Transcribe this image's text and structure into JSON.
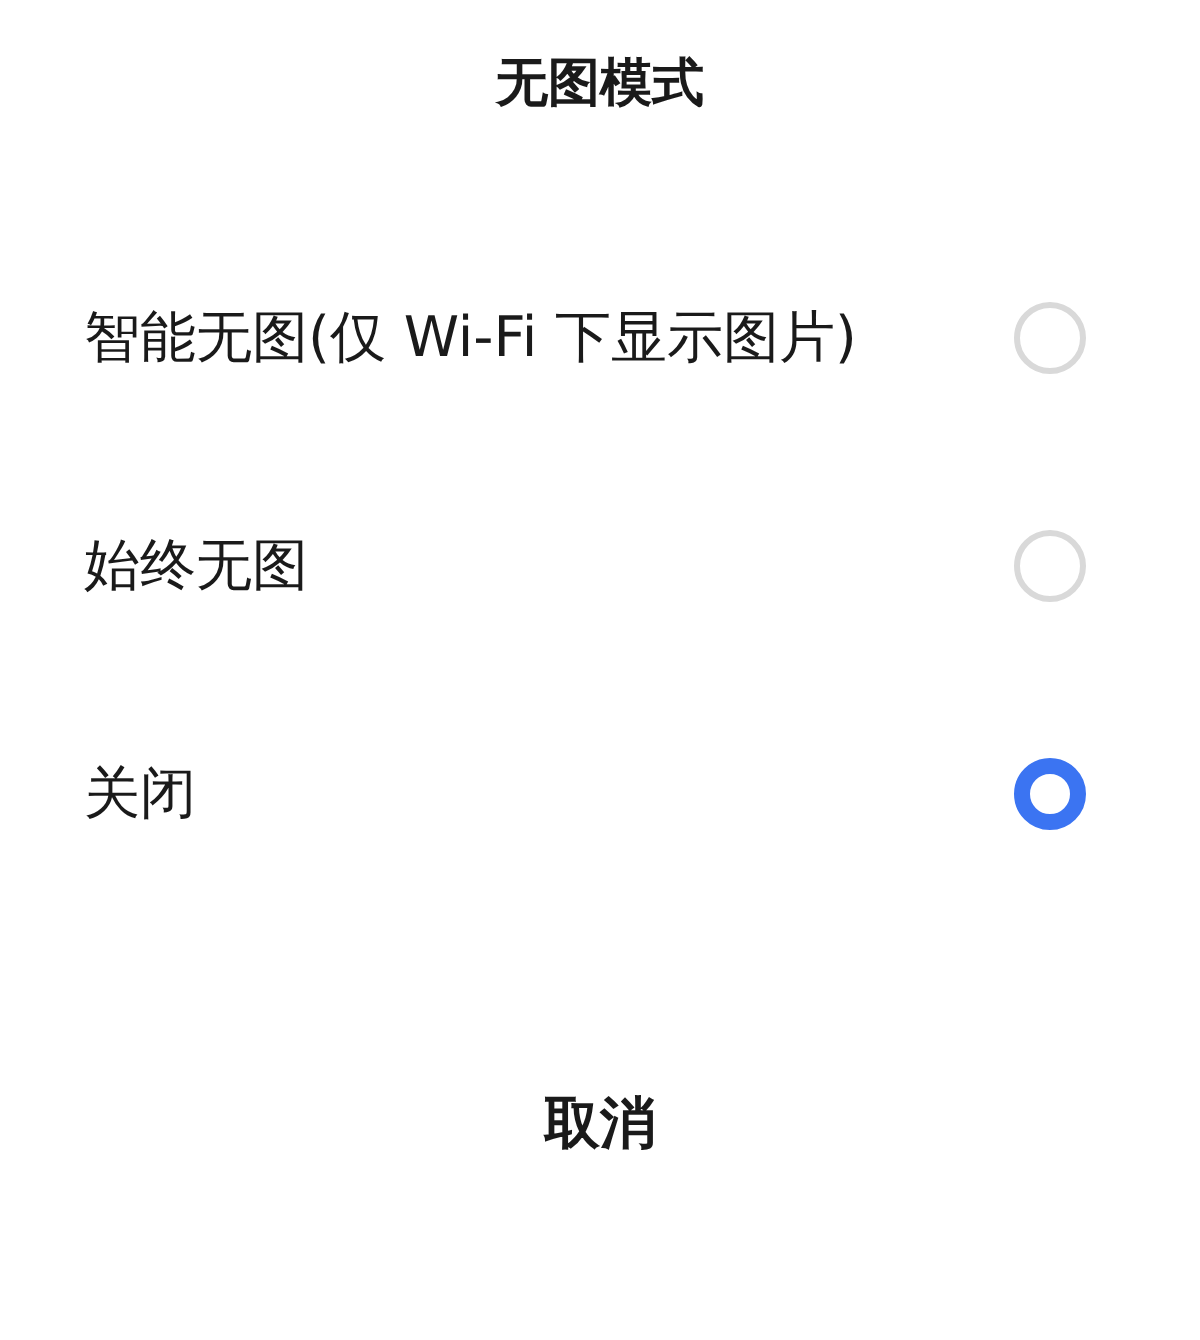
{
  "dialog": {
    "title": "无图模式",
    "options": [
      {
        "label": "智能无图(仅 Wi-Fi 下显示图片)",
        "selected": false
      },
      {
        "label": "始终无图",
        "selected": false
      },
      {
        "label": "关闭",
        "selected": true
      }
    ],
    "cancel_button": "取消"
  }
}
